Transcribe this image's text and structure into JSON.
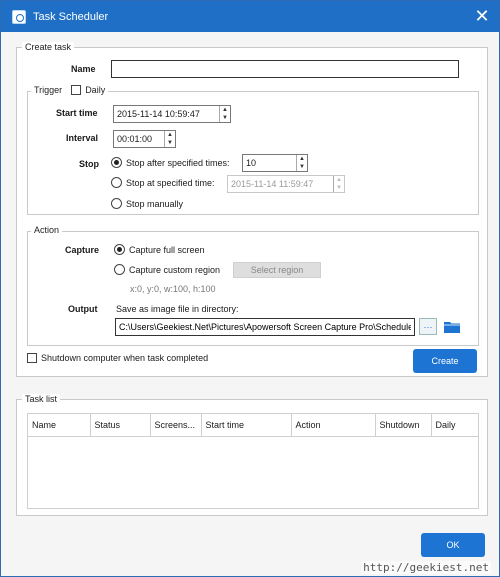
{
  "window": {
    "title": "Task Scheduler"
  },
  "create_task": {
    "label": "Create task",
    "name_label": "Name",
    "name_value": "",
    "trigger": {
      "label": "Trigger",
      "daily_label": "Daily",
      "daily_checked": false,
      "start_time_label": "Start time",
      "start_time_value": "2015-11-14 10:59:47",
      "interval_label": "Interval",
      "interval_value": "00:01:00",
      "stop_label": "Stop",
      "stop_options": [
        {
          "label": "Stop after specified times:",
          "checked": true,
          "value": "10"
        },
        {
          "label": "Stop at specified time:",
          "checked": false,
          "value": "2015-11-14 11:59:47"
        },
        {
          "label": "Stop manually",
          "checked": false
        }
      ]
    },
    "action": {
      "label": "Action",
      "capture_label": "Capture",
      "capture_options": [
        {
          "label": "Capture full screen",
          "checked": true
        },
        {
          "label": "Capture custom region",
          "checked": false
        }
      ],
      "select_region_label": "Select region",
      "region_info": "x:0, y:0, w:100, h:100",
      "output_label": "Output",
      "output_desc": "Save as image file in directory:",
      "output_path": "C:\\Users\\Geekiest.Net\\Pictures\\Apowersoft Screen Capture Pro\\Schedule",
      "browse_label": "···",
      "folder_icon": "folder-icon"
    },
    "shutdown_label": "Shutdown computer when task completed",
    "shutdown_checked": false,
    "create_button": "Create"
  },
  "task_list": {
    "label": "Task list",
    "columns": [
      "Name",
      "Status",
      "Screens...",
      "Start time",
      "Action",
      "Shutdown",
      "Daily"
    ],
    "rows": []
  },
  "ok_button": "OK",
  "watermark": "http://geekiest.net",
  "colors": {
    "accent": "#1d74d2",
    "titlebar": "#1f6fc6"
  }
}
